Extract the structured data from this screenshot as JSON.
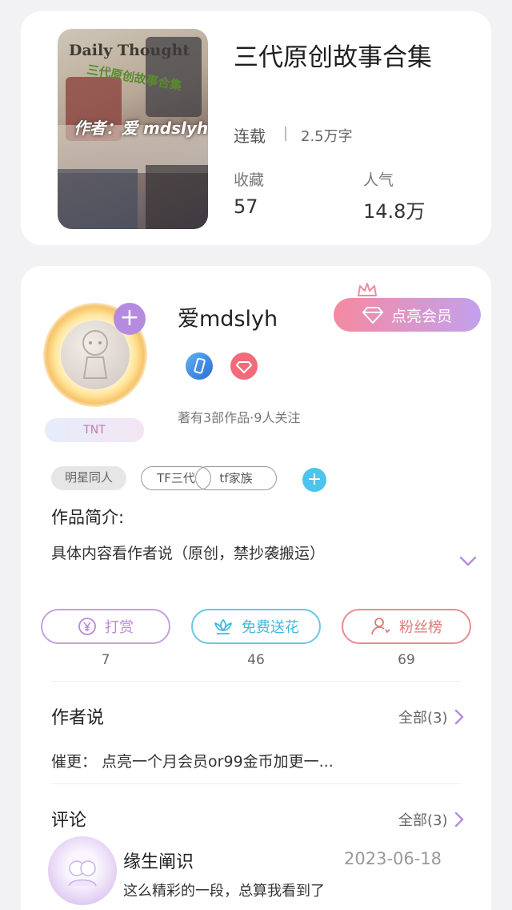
{
  "book": {
    "cover_title": "Daily Thought",
    "cover_subtitle": "三代原创故事合集",
    "cover_author": "作者：爱 mdslyh",
    "title": "三代原创故事合集",
    "status": "连载",
    "word_count": "2.5万字",
    "stats": [
      {
        "label": "收藏",
        "value": "57"
      },
      {
        "label": "人气",
        "value": "14.8万"
      }
    ]
  },
  "author": {
    "name": "爱mdslyh",
    "fan_badge": "TNT",
    "vip_button_label": "点亮会员",
    "meta": "著有3部作品·9人关注",
    "badges": [
      "phone-badge-icon",
      "diamond-badge-icon"
    ]
  },
  "tags": [
    {
      "label": "明星同人",
      "style": "filled"
    },
    {
      "label": "TF三代",
      "style": "outline"
    },
    {
      "label": "tf家族",
      "style": "outline"
    }
  ],
  "intro": {
    "label": "作品简介:",
    "text": "具体内容看作者说（原创，禁抄袭搬运）"
  },
  "actions": [
    {
      "label": "打赏",
      "count": "7",
      "color": "#b98ad8",
      "icon": "yen-coin-icon"
    },
    {
      "label": "免费送花",
      "count": "46",
      "color": "#44b8e0",
      "icon": "flower-icon"
    },
    {
      "label": "粉丝榜",
      "count": "69",
      "color": "#e07a7a",
      "icon": "fan-user-icon"
    }
  ],
  "author_say": {
    "title": "作者说",
    "all_label": "全部(3)",
    "text": "催更：  点亮一个月会员or99金币加更一..."
  },
  "comments": {
    "title": "评论",
    "all_label": "全部(3)",
    "items": [
      {
        "name": "缘生阐识",
        "date": "2023-06-18",
        "text": "这么精彩的一段，总算我看到了"
      }
    ]
  },
  "colors": {
    "accent_purple": "#b58be0",
    "accent_blue": "#4dc4ee",
    "vip_gradient_start": "#f58aa0",
    "vip_gradient_end": "#c3a0ee"
  }
}
